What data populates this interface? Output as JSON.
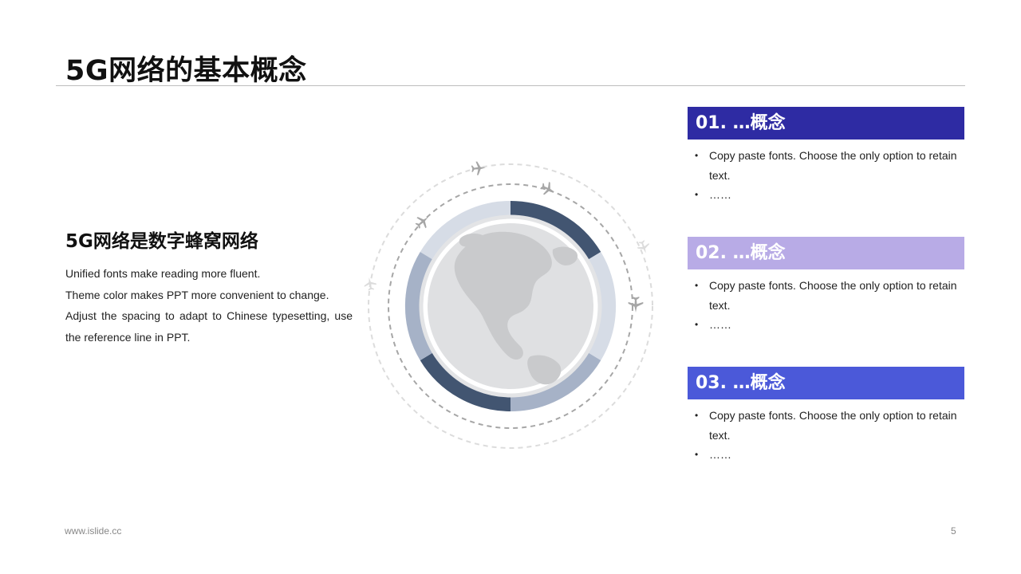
{
  "slide": {
    "title": "5G网络的基本概念"
  },
  "left": {
    "subheading": "5G网络是数字蜂窝网络",
    "lines": [
      "Unified fonts make reading more fluent.",
      "Theme color makes PPT more convenient to change.",
      "Adjust the spacing to adapt to Chinese typesetting, use",
      "the reference line in PPT."
    ]
  },
  "cards": [
    {
      "heading": "01. …概念",
      "color": "#2e2ba3",
      "bullets": [
        "Copy paste fonts. Choose the only option to retain text.",
        "……"
      ]
    },
    {
      "heading": "02. …概念",
      "color": "#b8abe6",
      "bullets": [
        "Copy paste fonts. Choose the only option to retain text.",
        "……"
      ]
    },
    {
      "heading": "03. …概念",
      "color": "#4b59d9",
      "bullets": [
        "Copy paste fonts. Choose the only option to retain text.",
        "……"
      ]
    }
  ],
  "graphic": {
    "icon": "globe-icon",
    "plane_icon": "airplane-icon",
    "colors": {
      "dark_segment": "#425571",
      "mid_segment": "#a6b2c7",
      "light_segment": "#d6dce6",
      "globe_bg": "#e3e4e6",
      "land": "#c9cacc",
      "dashed_inner": "#a6a6a6",
      "dashed_outer": "#dcdcdc"
    }
  },
  "footer": {
    "url": "www.islide.cc",
    "page_number": "5"
  }
}
